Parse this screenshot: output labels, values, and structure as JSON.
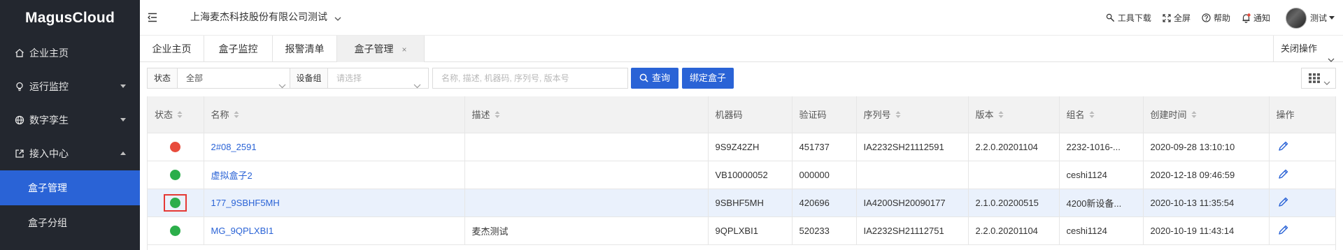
{
  "app": {
    "title": "MagusCloud"
  },
  "sidebar": {
    "items": [
      {
        "label": "企业主页",
        "icon": "home-icon"
      },
      {
        "label": "运行监控",
        "icon": "bulb-icon"
      },
      {
        "label": "数字孪生",
        "icon": "globe-icon"
      },
      {
        "label": "接入中心",
        "icon": "external-link-icon"
      }
    ],
    "sub_items": [
      {
        "label": "盒子管理",
        "active": true
      },
      {
        "label": "盒子分组",
        "active": false
      }
    ]
  },
  "header": {
    "company": "上海麦杰科技股份有限公司测试",
    "links": {
      "tools": "工具下载",
      "fullscreen": "全屏",
      "help": "帮助",
      "notify": "通知"
    },
    "user": "测试"
  },
  "tabs": {
    "items": [
      {
        "label": "企业主页"
      },
      {
        "label": "盒子监控"
      },
      {
        "label": "报警清单"
      },
      {
        "label": "盒子管理",
        "closable": "×"
      }
    ],
    "close_ops": "关闭操作"
  },
  "filter": {
    "status_label": "状态",
    "status_value": "全部",
    "group_label": "设备组",
    "group_placeholder": "请选择",
    "search_placeholder": "名称, 描述, 机器码, 序列号, 版本号",
    "query_button": "查询",
    "bind_button": "绑定盒子"
  },
  "table": {
    "columns": [
      "状态",
      "名称",
      "描述",
      "机器码",
      "验证码",
      "序列号",
      "版本",
      "组名",
      "创建时间",
      "操作"
    ],
    "rows": [
      {
        "status": "red",
        "name": "2#08_2591",
        "desc": "",
        "machine_code": "9S9Z42ZH",
        "verify_code": "451737",
        "serial": "IA2232SH21112591",
        "version": "2.2.0.20201104",
        "group": "2232-1016-...",
        "created": "2020-09-28 13:10:10"
      },
      {
        "status": "green",
        "name": "虚拟盒子2",
        "desc": "",
        "machine_code": "VB10000052",
        "verify_code": "000000",
        "serial": "",
        "version": "",
        "group": "ceshi1124",
        "created": "2020-12-18 09:46:59"
      },
      {
        "status": "green",
        "name": "177_9SBHF5MH",
        "desc": "",
        "machine_code": "9SBHF5MH",
        "verify_code": "420696",
        "serial": "IA4200SH20090177",
        "version": "2.1.0.20200515",
        "group": "4200新设备...",
        "created": "2020-10-13 11:35:54"
      },
      {
        "status": "green",
        "name": "MG_9QPLXBI1",
        "desc": "麦杰测试",
        "machine_code": "9QPLXBI1",
        "verify_code": "520233",
        "serial": "IA2232SH21112751",
        "version": "2.2.0.20201104",
        "group": "ceshi1124",
        "created": "2020-10-19 11:43:14"
      }
    ]
  },
  "colors": {
    "sidebar_bg": "#23272f",
    "accent": "#2a63d6",
    "status_red": "#e84b3c",
    "status_green": "#2bae4a",
    "highlight_row": "#eaf1fc",
    "selection_box": "#e53935"
  }
}
